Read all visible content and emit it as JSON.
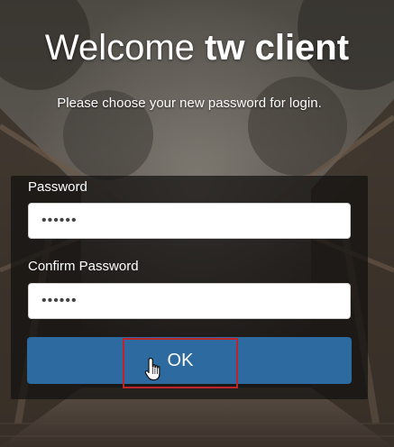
{
  "header": {
    "welcome_text": "Welcome",
    "client_name": "tw client",
    "instruction": "Please choose your new password for login."
  },
  "form": {
    "password_label": "Password",
    "password_value": "••••••",
    "confirm_label": "Confirm Password",
    "confirm_value": "••••••",
    "ok_label": "OK"
  },
  "theme": {
    "button_color": "#2c6aa0",
    "focus_outline_color": "#c0232b"
  },
  "icons": {
    "pointer": "hand-pointer-cursor-icon"
  }
}
